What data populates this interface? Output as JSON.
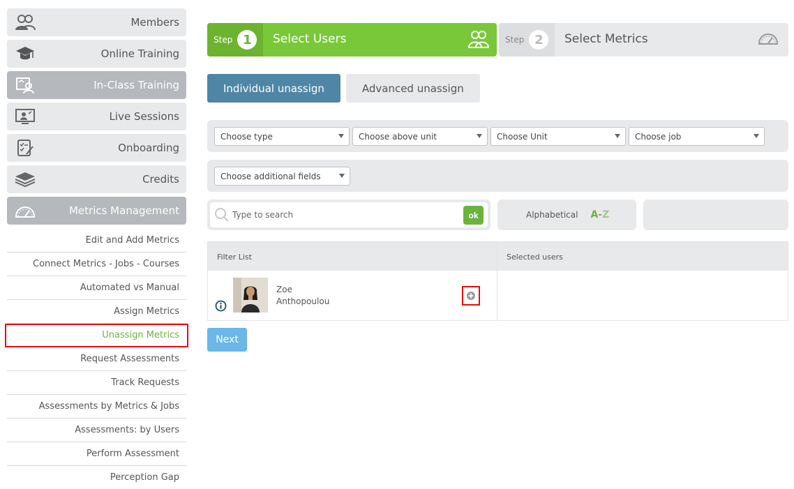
{
  "sidebar": {
    "menu": [
      {
        "label": "Members",
        "icon": "members-icon"
      },
      {
        "label": "Online Training",
        "icon": "graduation-cap-icon"
      },
      {
        "label": "In-Class Training",
        "icon": "classroom-icon"
      },
      {
        "label": "Live Sessions",
        "icon": "live-session-icon"
      },
      {
        "label": "Onboarding",
        "icon": "onboarding-checklist-icon"
      },
      {
        "label": "Credits",
        "icon": "credits-stack-icon"
      },
      {
        "label": "Metrics Management",
        "icon": "gauge-icon"
      }
    ],
    "submenu": [
      "Edit and Add Metrics",
      "Connect Metrics - Jobs - Courses",
      "Automated vs Manual",
      "Assign Metrics",
      "Unassign Metrics",
      "Request Assessments",
      "Track Requests",
      "Assessments by Metrics & Jobs",
      "Assessments: by Users",
      "Perform Assessment",
      "Perception Gap"
    ],
    "active_submenu": "Unassign Metrics"
  },
  "steps": {
    "step_word": "Step",
    "step1": {
      "number": "1",
      "title": "Select Users",
      "icon": "users-icon"
    },
    "step2": {
      "number": "2",
      "title": "Select Metrics",
      "icon": "gauge-icon"
    }
  },
  "tabs": {
    "individual": "Individual unassign",
    "advanced": "Advanced unassign"
  },
  "filters": {
    "type": "Choose type",
    "above_unit": "Choose above unit",
    "unit": "Choose Unit",
    "job": "Choose job",
    "additional": "Choose additional fields"
  },
  "search": {
    "placeholder": "Type to search",
    "ok_label": "ok"
  },
  "sort": {
    "label": "Alphabetical",
    "a": "A",
    "dash": "-",
    "z": "Z"
  },
  "table": {
    "filter_list_header": "Filter List",
    "selected_users_header": "Selected users",
    "users": [
      {
        "first_name": "Zoe",
        "last_name": "Anthopoulou"
      }
    ]
  },
  "buttons": {
    "next": "Next"
  },
  "colors": {
    "green": "#79c83a",
    "blue_tab": "#4f86a6",
    "next_blue": "#6ab7e8",
    "highlight_red": "#e01010"
  }
}
